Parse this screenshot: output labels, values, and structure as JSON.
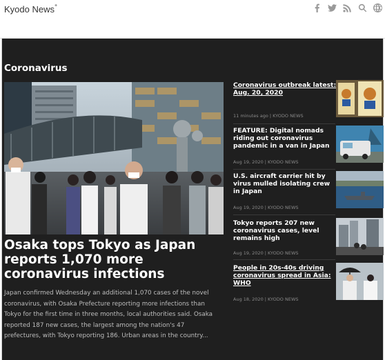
{
  "header": {
    "logo": "Kyodo News",
    "logo_mark": "+",
    "icons": [
      "facebook-icon",
      "twitter-icon",
      "rss-icon",
      "search-icon",
      "globe-icon"
    ]
  },
  "section": {
    "title": "Coronavirus"
  },
  "lead": {
    "headline": "Osaka tops Tokyo as Japan reports 1,070 more coronavirus infections",
    "summary": "Japan confirmed Wednesday an additional 1,070 cases of the novel coronavirus, with Osaka Prefecture reporting more infections than Tokyo for the first time in three months, local authorities said. Osaka reported 187 new cases, the largest among the nation's 47 prefectures, with Tokyo reporting 186. Urban areas in the country..."
  },
  "stories": [
    {
      "title": "Coronavirus outbreak latest: Aug. 20, 2020",
      "meta": "11 minutes ago | KYODO NEWS"
    },
    {
      "title": "FEATURE: Digital nomads riding out coronavirus pandemic in a van in Japan",
      "meta": "Aug 19, 2020 | KYODO NEWS"
    },
    {
      "title": "U.S. aircraft carrier hit by virus mulled isolating crew in Japan",
      "meta": "Aug 19, 2020 | KYODO NEWS"
    },
    {
      "title": "Tokyo reports 207 new coronavirus cases, level remains high",
      "meta": "Aug 19, 2020 | KYODO NEWS"
    },
    {
      "title": "People in 20s-40s driving coronavirus spread in Asia: WHO",
      "meta": "Aug 18, 2020 | KYODO NEWS"
    }
  ]
}
